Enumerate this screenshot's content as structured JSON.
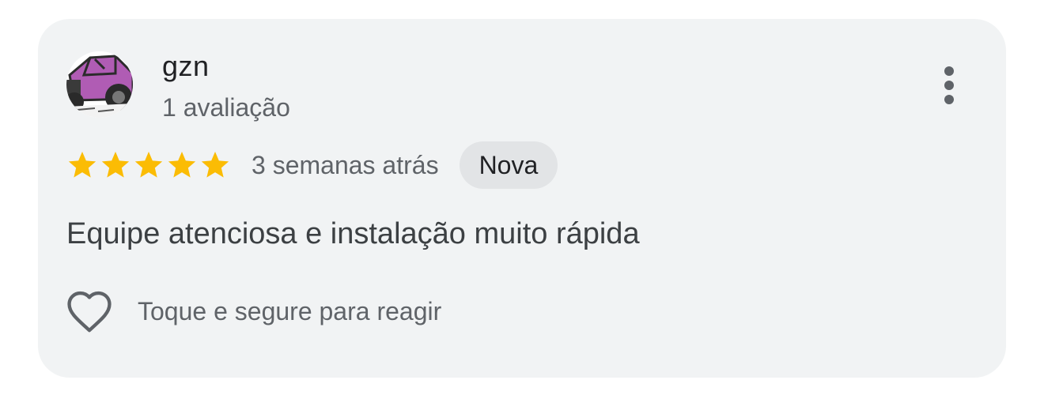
{
  "review": {
    "author": "gzn",
    "author_meta": "1 avaliação",
    "rating": 5,
    "rating_max": 5,
    "time_ago": "3 semanas atrás",
    "badge": "Nova",
    "text": "Equipe atenciosa e instalação muito rápida",
    "react_label": "Toque e segure para reagir"
  },
  "icons": {
    "more": "more-vert-icon",
    "star": "star-icon",
    "heart": "heart-outline-icon"
  },
  "colors": {
    "card_bg": "#f1f3f4",
    "star": "#fbbc04",
    "badge_bg": "#e2e4e6",
    "avatar_car": "#b05cb4"
  }
}
